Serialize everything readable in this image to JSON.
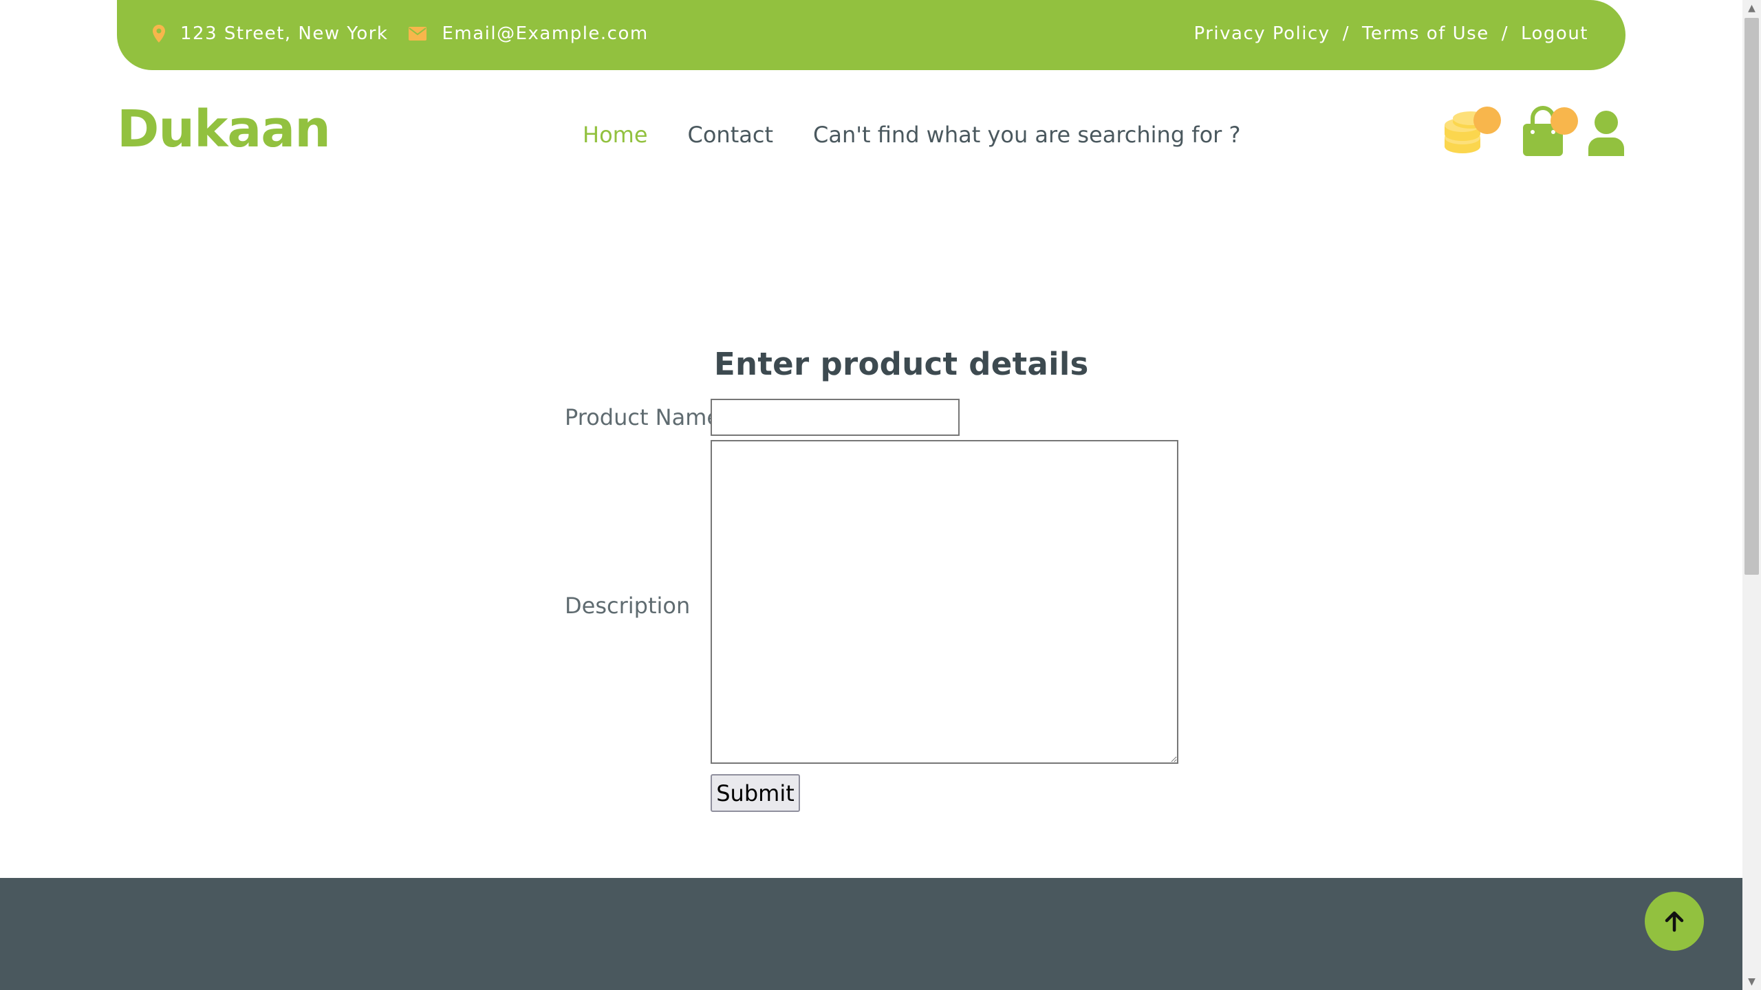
{
  "topbar": {
    "address": "123 Street, New York",
    "email": "Email@Example.com",
    "links": {
      "privacy": "Privacy Policy",
      "terms": "Terms of Use",
      "logout": "Logout",
      "separator": "/"
    },
    "icons": {
      "location": "map-marker-icon",
      "email": "envelope-icon"
    },
    "accent_color": "#f8b64c",
    "bar_color": "#92c13f"
  },
  "header": {
    "logo": "Dukaan",
    "nav": {
      "home": "Home",
      "contact": "Contact",
      "search_help": "Can't find what you are searching for ?"
    },
    "icons": [
      "coins-icon",
      "shopping-bag-icon",
      "user-icon"
    ]
  },
  "form": {
    "title": "Enter product details",
    "product_name_label": "Product Name",
    "product_name_value": "",
    "description_label": "Description",
    "description_value": "",
    "submit_label": "Submit"
  },
  "footer": {
    "color": "#4a585e",
    "back_to_top_icon": "arrow-up-icon"
  }
}
